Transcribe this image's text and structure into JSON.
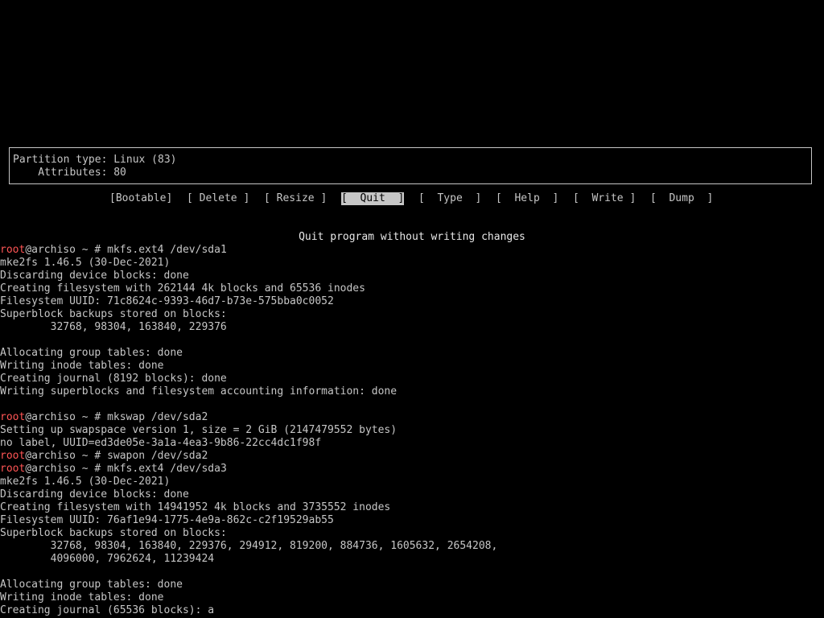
{
  "colors": {
    "background": "#000000",
    "foreground": "#c6c6c6",
    "prompt_user": "#ff5555",
    "selected_bg": "#c6c6c6",
    "selected_fg": "#000000"
  },
  "info_box": {
    "line1": "Partition type: Linux (83)",
    "line2": "    Attributes: 80"
  },
  "menu": [
    {
      "label": "[Bootable]",
      "selected": false
    },
    {
      "label": "[ Delete ]",
      "selected": false
    },
    {
      "label": "[ Resize ]",
      "selected": false
    },
    {
      "label": "[  Quit  ]",
      "selected": true
    },
    {
      "label": "[  Type  ]",
      "selected": false
    },
    {
      "label": "[  Help  ]",
      "selected": false
    },
    {
      "label": "[  Write ]",
      "selected": false
    },
    {
      "label": "[  Dump  ]",
      "selected": false
    }
  ],
  "hint": "Quit program without writing changes",
  "console": {
    "prompt_user": "root",
    "prompt_rest": "@archiso ~ # ",
    "lines": [
      {
        "type": "cmd",
        "text": "mkfs.ext4 /dev/sda1"
      },
      {
        "type": "out",
        "text": "mke2fs 1.46.5 (30-Dec-2021)"
      },
      {
        "type": "out",
        "text": "Discarding device blocks: done"
      },
      {
        "type": "out",
        "text": "Creating filesystem with 262144 4k blocks and 65536 inodes"
      },
      {
        "type": "out",
        "text": "Filesystem UUID: 71c8624c-9393-46d7-b73e-575bba0c0052"
      },
      {
        "type": "out",
        "text": "Superblock backups stored on blocks:"
      },
      {
        "type": "out",
        "text": "        32768, 98304, 163840, 229376"
      },
      {
        "type": "out",
        "text": ""
      },
      {
        "type": "out",
        "text": "Allocating group tables: done"
      },
      {
        "type": "out",
        "text": "Writing inode tables: done"
      },
      {
        "type": "out",
        "text": "Creating journal (8192 blocks): done"
      },
      {
        "type": "out",
        "text": "Writing superblocks and filesystem accounting information: done"
      },
      {
        "type": "out",
        "text": ""
      },
      {
        "type": "cmd",
        "text": "mkswap /dev/sda2"
      },
      {
        "type": "out",
        "text": "Setting up swapspace version 1, size = 2 GiB (2147479552 bytes)"
      },
      {
        "type": "out",
        "text": "no label, UUID=ed3de05e-3a1a-4ea3-9b86-22cc4dc1f98f"
      },
      {
        "type": "cmd",
        "text": "swapon /dev/sda2"
      },
      {
        "type": "cmd",
        "text": "mkfs.ext4 /dev/sda3"
      },
      {
        "type": "out",
        "text": "mke2fs 1.46.5 (30-Dec-2021)"
      },
      {
        "type": "out",
        "text": "Discarding device blocks: done"
      },
      {
        "type": "out",
        "text": "Creating filesystem with 14941952 4k blocks and 3735552 inodes"
      },
      {
        "type": "out",
        "text": "Filesystem UUID: 76af1e94-1775-4e9a-862c-c2f19529ab55"
      },
      {
        "type": "out",
        "text": "Superblock backups stored on blocks:"
      },
      {
        "type": "out",
        "text": "        32768, 98304, 163840, 229376, 294912, 819200, 884736, 1605632, 2654208,"
      },
      {
        "type": "out",
        "text": "        4096000, 7962624, 11239424"
      },
      {
        "type": "out",
        "text": ""
      },
      {
        "type": "out",
        "text": "Allocating group tables: done"
      },
      {
        "type": "out",
        "text": "Writing inode tables: done"
      },
      {
        "type": "out",
        "text": "Creating journal (65536 blocks): a"
      }
    ]
  }
}
